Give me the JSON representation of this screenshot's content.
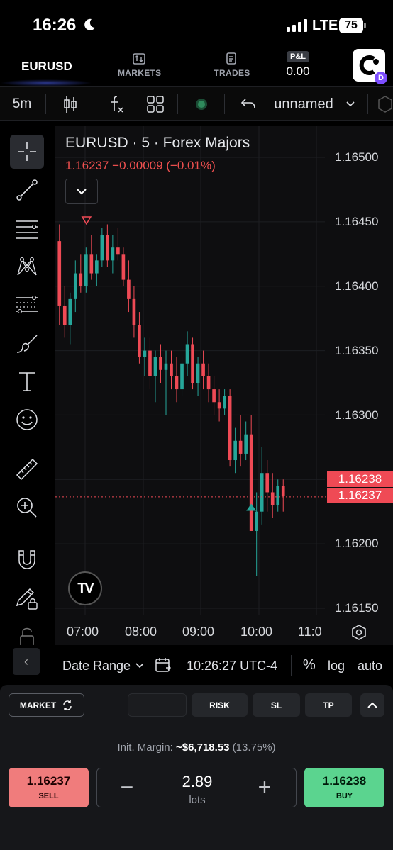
{
  "status_bar": {
    "time": "16:26",
    "network": "LTE",
    "battery": "75"
  },
  "nav": {
    "brand": "EURUSD",
    "markets_label": "MARKETS",
    "trades_label": "TRADES",
    "pnl_label": "P&L",
    "pnl_value": "0.00",
    "avatar_badge": "D"
  },
  "toolbar": {
    "interval": "5m",
    "layout_name": "unnamed"
  },
  "chart": {
    "title": "EURUSD · 5 · Forex Majors",
    "quote": "1.16237  −0.00009 (−0.01%)",
    "price_tag_ask": "1.16238",
    "price_tag_bid": "1.16237",
    "tv_logo": "TV",
    "y_labels": [
      "1.16500",
      "1.16450",
      "1.16400",
      "1.16350",
      "1.16300",
      "1.16200",
      "1.16150"
    ],
    "x_labels": [
      "07:00",
      "08:00",
      "09:00",
      "10:00",
      "11:0"
    ],
    "colors": {
      "up": "#26a69a",
      "down": "#ef4a55",
      "background": "#0e0e10"
    }
  },
  "chart_data": {
    "type": "candlestick",
    "title": "EURUSD · 5 · Forex Majors",
    "ylim": [
      1.1613,
      1.1652
    ],
    "x_ticks": [
      "07:00",
      "08:00",
      "09:00",
      "10:00",
      "11:0"
    ],
    "last_price": 1.16237,
    "candles_ohlc": [
      [
        1.16435,
        1.16448,
        1.1637,
        1.16385
      ],
      [
        1.16385,
        1.164,
        1.1636,
        1.1637
      ],
      [
        1.1637,
        1.16395,
        1.16355,
        1.1639
      ],
      [
        1.1639,
        1.1642,
        1.1638,
        1.1641
      ],
      [
        1.1641,
        1.16425,
        1.16395,
        1.164
      ],
      [
        1.164,
        1.1643,
        1.16395,
        1.16425
      ],
      [
        1.16425,
        1.1644,
        1.16405,
        1.1641
      ],
      [
        1.1641,
        1.16425,
        1.164,
        1.1642
      ],
      [
        1.1642,
        1.16445,
        1.16415,
        1.1644
      ],
      [
        1.1644,
        1.16448,
        1.16415,
        1.1642
      ],
      [
        1.1642,
        1.1644,
        1.1641,
        1.1643
      ],
      [
        1.1643,
        1.16445,
        1.1642,
        1.16425
      ],
      [
        1.16425,
        1.1643,
        1.164,
        1.16405
      ],
      [
        1.16405,
        1.1642,
        1.1638,
        1.1639
      ],
      [
        1.1639,
        1.164,
        1.1636,
        1.1637
      ],
      [
        1.1637,
        1.1638,
        1.1634,
        1.16345
      ],
      [
        1.16345,
        1.1636,
        1.1633,
        1.1635
      ],
      [
        1.1635,
        1.1636,
        1.1632,
        1.1633
      ],
      [
        1.1633,
        1.1635,
        1.1631,
        1.16345
      ],
      [
        1.16345,
        1.16355,
        1.16325,
        1.16335
      ],
      [
        1.16335,
        1.1635,
        1.163,
        1.1634
      ],
      [
        1.1634,
        1.1635,
        1.1632,
        1.1633
      ],
      [
        1.1633,
        1.16345,
        1.1631,
        1.1632
      ],
      [
        1.1632,
        1.16345,
        1.16315,
        1.1634
      ],
      [
        1.1634,
        1.16365,
        1.1633,
        1.16355
      ],
      [
        1.16355,
        1.1636,
        1.1632,
        1.16325
      ],
      [
        1.16325,
        1.16345,
        1.16315,
        1.1634
      ],
      [
        1.1634,
        1.1635,
        1.1632,
        1.1633
      ],
      [
        1.1633,
        1.1634,
        1.1631,
        1.1632
      ],
      [
        1.1632,
        1.1633,
        1.163,
        1.1631
      ],
      [
        1.1631,
        1.1632,
        1.16295,
        1.16305
      ],
      [
        1.16305,
        1.1632,
        1.163,
        1.16315
      ],
      [
        1.16315,
        1.1632,
        1.1626,
        1.16265
      ],
      [
        1.16265,
        1.1629,
        1.16255,
        1.1628
      ],
      [
        1.1628,
        1.163,
        1.1626,
        1.1627
      ],
      [
        1.1627,
        1.16295,
        1.16265,
        1.16285
      ],
      [
        1.16285,
        1.163,
        1.1624,
        1.1621
      ],
      [
        1.1621,
        1.1624,
        1.16175,
        1.16225
      ],
      [
        1.16225,
        1.16275,
        1.16215,
        1.16255
      ],
      [
        1.16255,
        1.16265,
        1.16225,
        1.1624
      ],
      [
        1.1624,
        1.16255,
        1.1622,
        1.1623
      ],
      [
        1.1623,
        1.1625,
        1.16225,
        1.16245
      ],
      [
        1.16245,
        1.1625,
        1.16225,
        1.16237
      ]
    ],
    "markers": [
      {
        "type": "sell-triangle",
        "candle_index": 8
      },
      {
        "type": "buy-triangle",
        "candle_index": 36
      }
    ]
  },
  "range_bar": {
    "date_range": "Date Range",
    "time": "10:26:27 UTC-4",
    "percent": "%",
    "log": "log",
    "auto": "auto"
  },
  "panel": {
    "order_type": "MARKET",
    "risk": "RISK",
    "sl": "SL",
    "tp": "TP",
    "margin_label": "Init. Margin:",
    "margin_value": "~$6,718.53",
    "margin_pct": "(13.75%)",
    "sell_price": "1.16237",
    "sell_label": "SELL",
    "buy_price": "1.16238",
    "buy_label": "BUY",
    "lots_value": "2.89",
    "lots_label": "lots"
  }
}
